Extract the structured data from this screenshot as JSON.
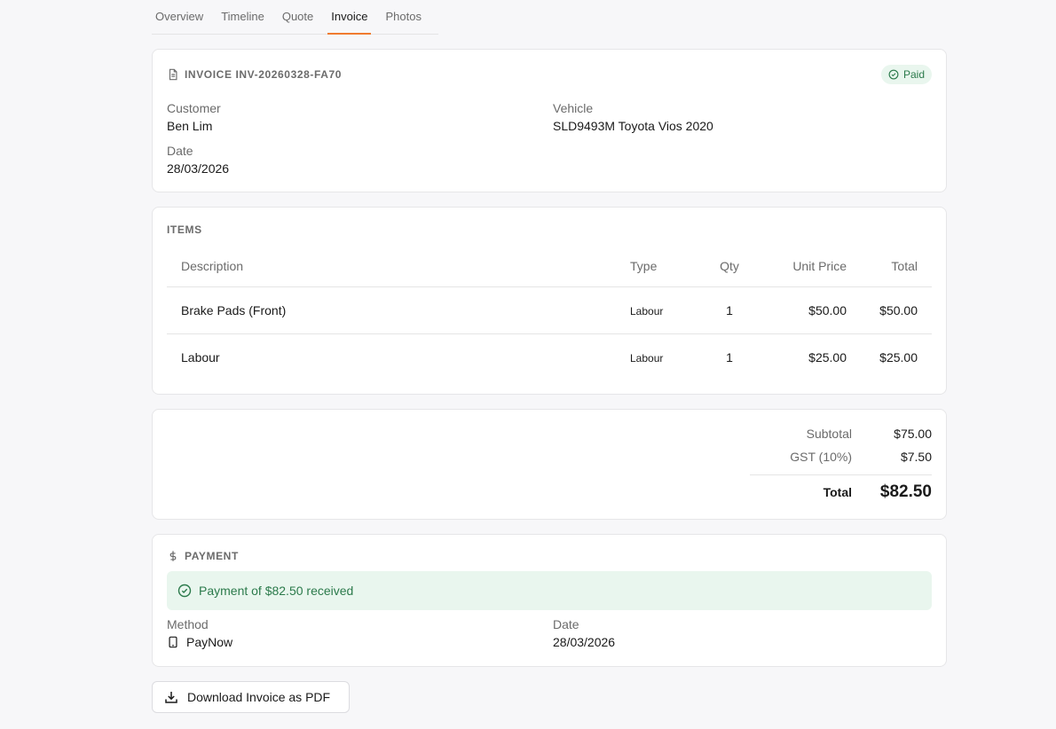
{
  "tabs": [
    {
      "label": "Overview"
    },
    {
      "label": "Timeline"
    },
    {
      "label": "Quote"
    },
    {
      "label": "Invoice",
      "active": true
    },
    {
      "label": "Photos"
    }
  ],
  "invoice": {
    "title": "INVOICE INV-20260328-FA70",
    "status_badge": "Paid",
    "customer_label": "Customer",
    "customer_value": "Ben Lim",
    "vehicle_label": "Vehicle",
    "vehicle_value": "SLD9493M Toyota Vios 2020",
    "date_label": "Date",
    "date_value": "28/03/2026"
  },
  "items": {
    "title": "ITEMS",
    "headers": [
      "Description",
      "Type",
      "Qty",
      "Unit Price",
      "Total"
    ],
    "rows": [
      {
        "description": "Brake Pads (Front)",
        "type": "Labour",
        "qty": "1",
        "unit_price": "$50.00",
        "total": "$50.00"
      },
      {
        "description": "Labour",
        "type": "Labour",
        "qty": "1",
        "unit_price": "$25.00",
        "total": "$25.00"
      }
    ]
  },
  "totals": {
    "subtotal_label": "Subtotal",
    "subtotal_value": "$75.00",
    "gst_label": "GST (10%)",
    "gst_value": "$7.50",
    "total_label": "Total",
    "total_value": "$82.50"
  },
  "payment": {
    "title": "PAYMENT",
    "banner": "Payment of $82.50 received",
    "method_label": "Method",
    "method_value": "PayNow",
    "date_label": "Date",
    "date_value": "28/03/2026"
  },
  "download_button": "Download Invoice as PDF",
  "colors": {
    "accent": "#f07b2f",
    "success_bg": "#e9f6ee",
    "success_text": "#2b7a4b"
  }
}
